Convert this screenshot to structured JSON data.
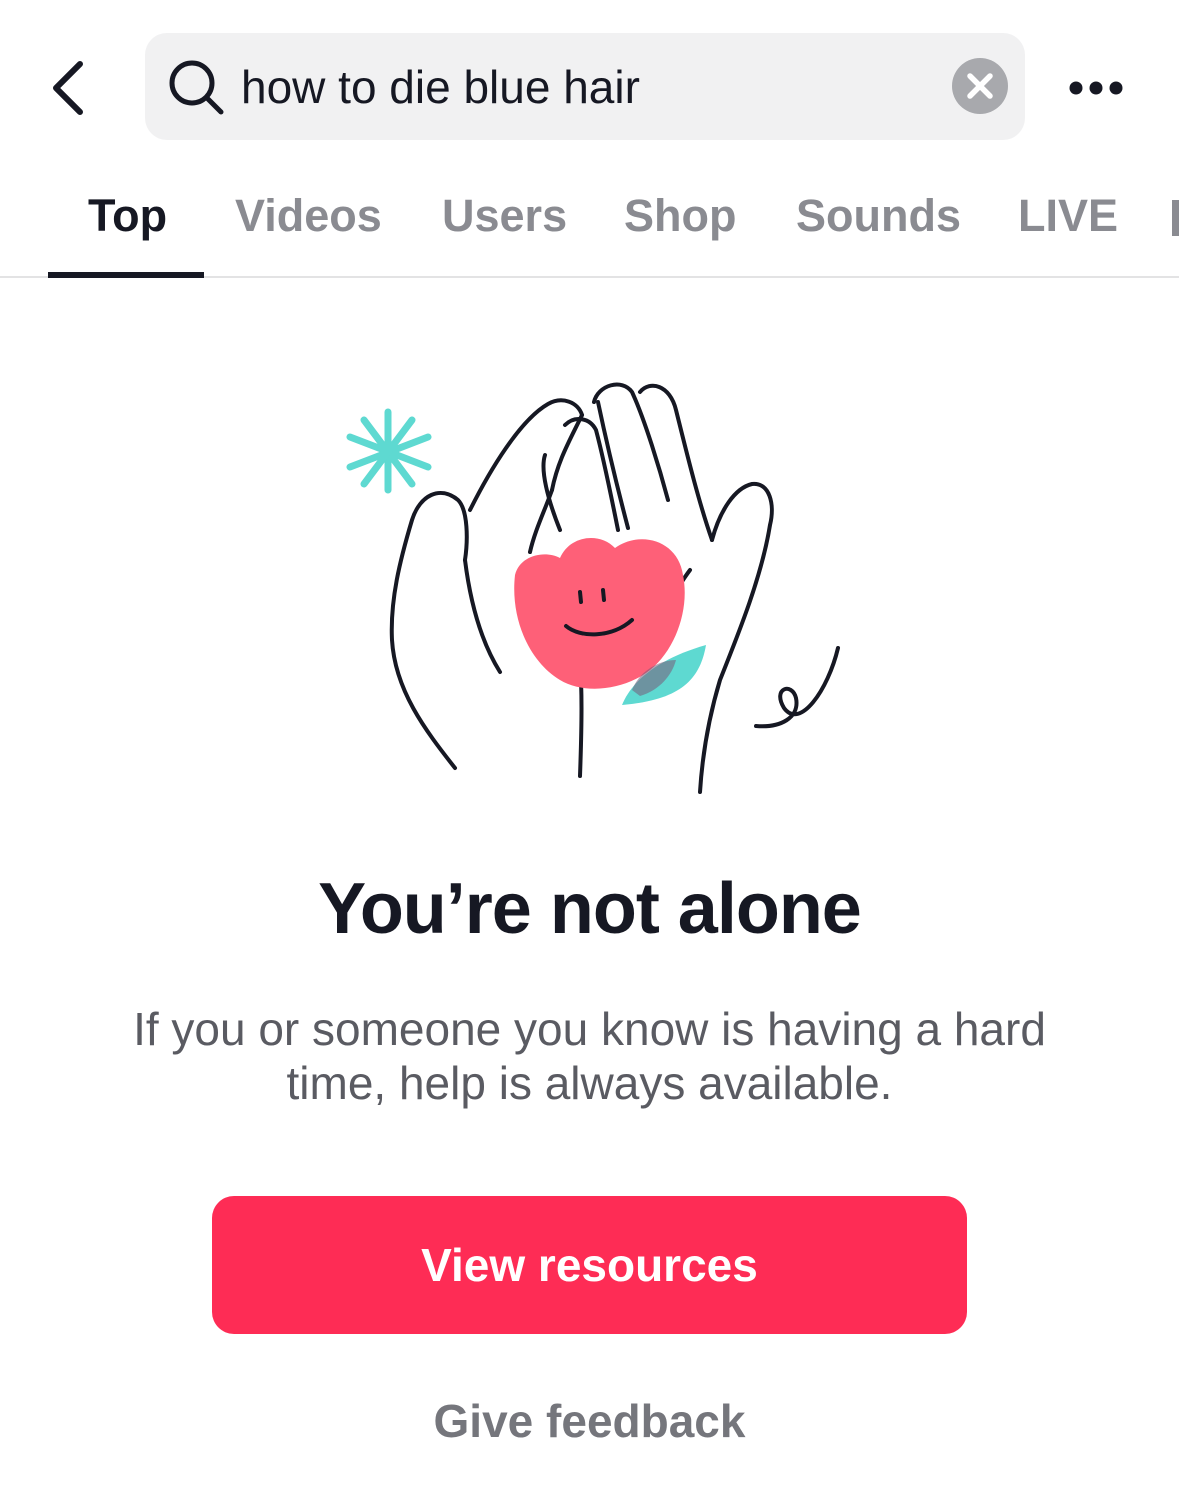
{
  "header": {
    "back_icon": "chevron-left-icon",
    "search": {
      "icon": "search-icon",
      "value": "how to die blue hair",
      "clear_icon": "clear-icon"
    },
    "more_icon": "more-horizontal-icon"
  },
  "tabs": [
    {
      "label": "Top",
      "active": true
    },
    {
      "label": "Videos",
      "active": false
    },
    {
      "label": "Users",
      "active": false
    },
    {
      "label": "Shop",
      "active": false
    },
    {
      "label": "Sounds",
      "active": false
    },
    {
      "label": "LIVE",
      "active": false
    }
  ],
  "notice": {
    "illustration_icon": "hands-holding-flower-icon",
    "title": "You’re not alone",
    "body": "If you or someone you know is having a hard time, help is always available.",
    "primary_button": "View resources",
    "secondary_link": "Give feedback"
  },
  "colors": {
    "accent": "#fe2c55",
    "flower": "#fe6078",
    "teal": "#5ed9d1",
    "text_primary": "#161823",
    "text_secondary": "#5a5b62",
    "tab_inactive": "#8a8b91",
    "search_bg": "#f1f1f2"
  }
}
